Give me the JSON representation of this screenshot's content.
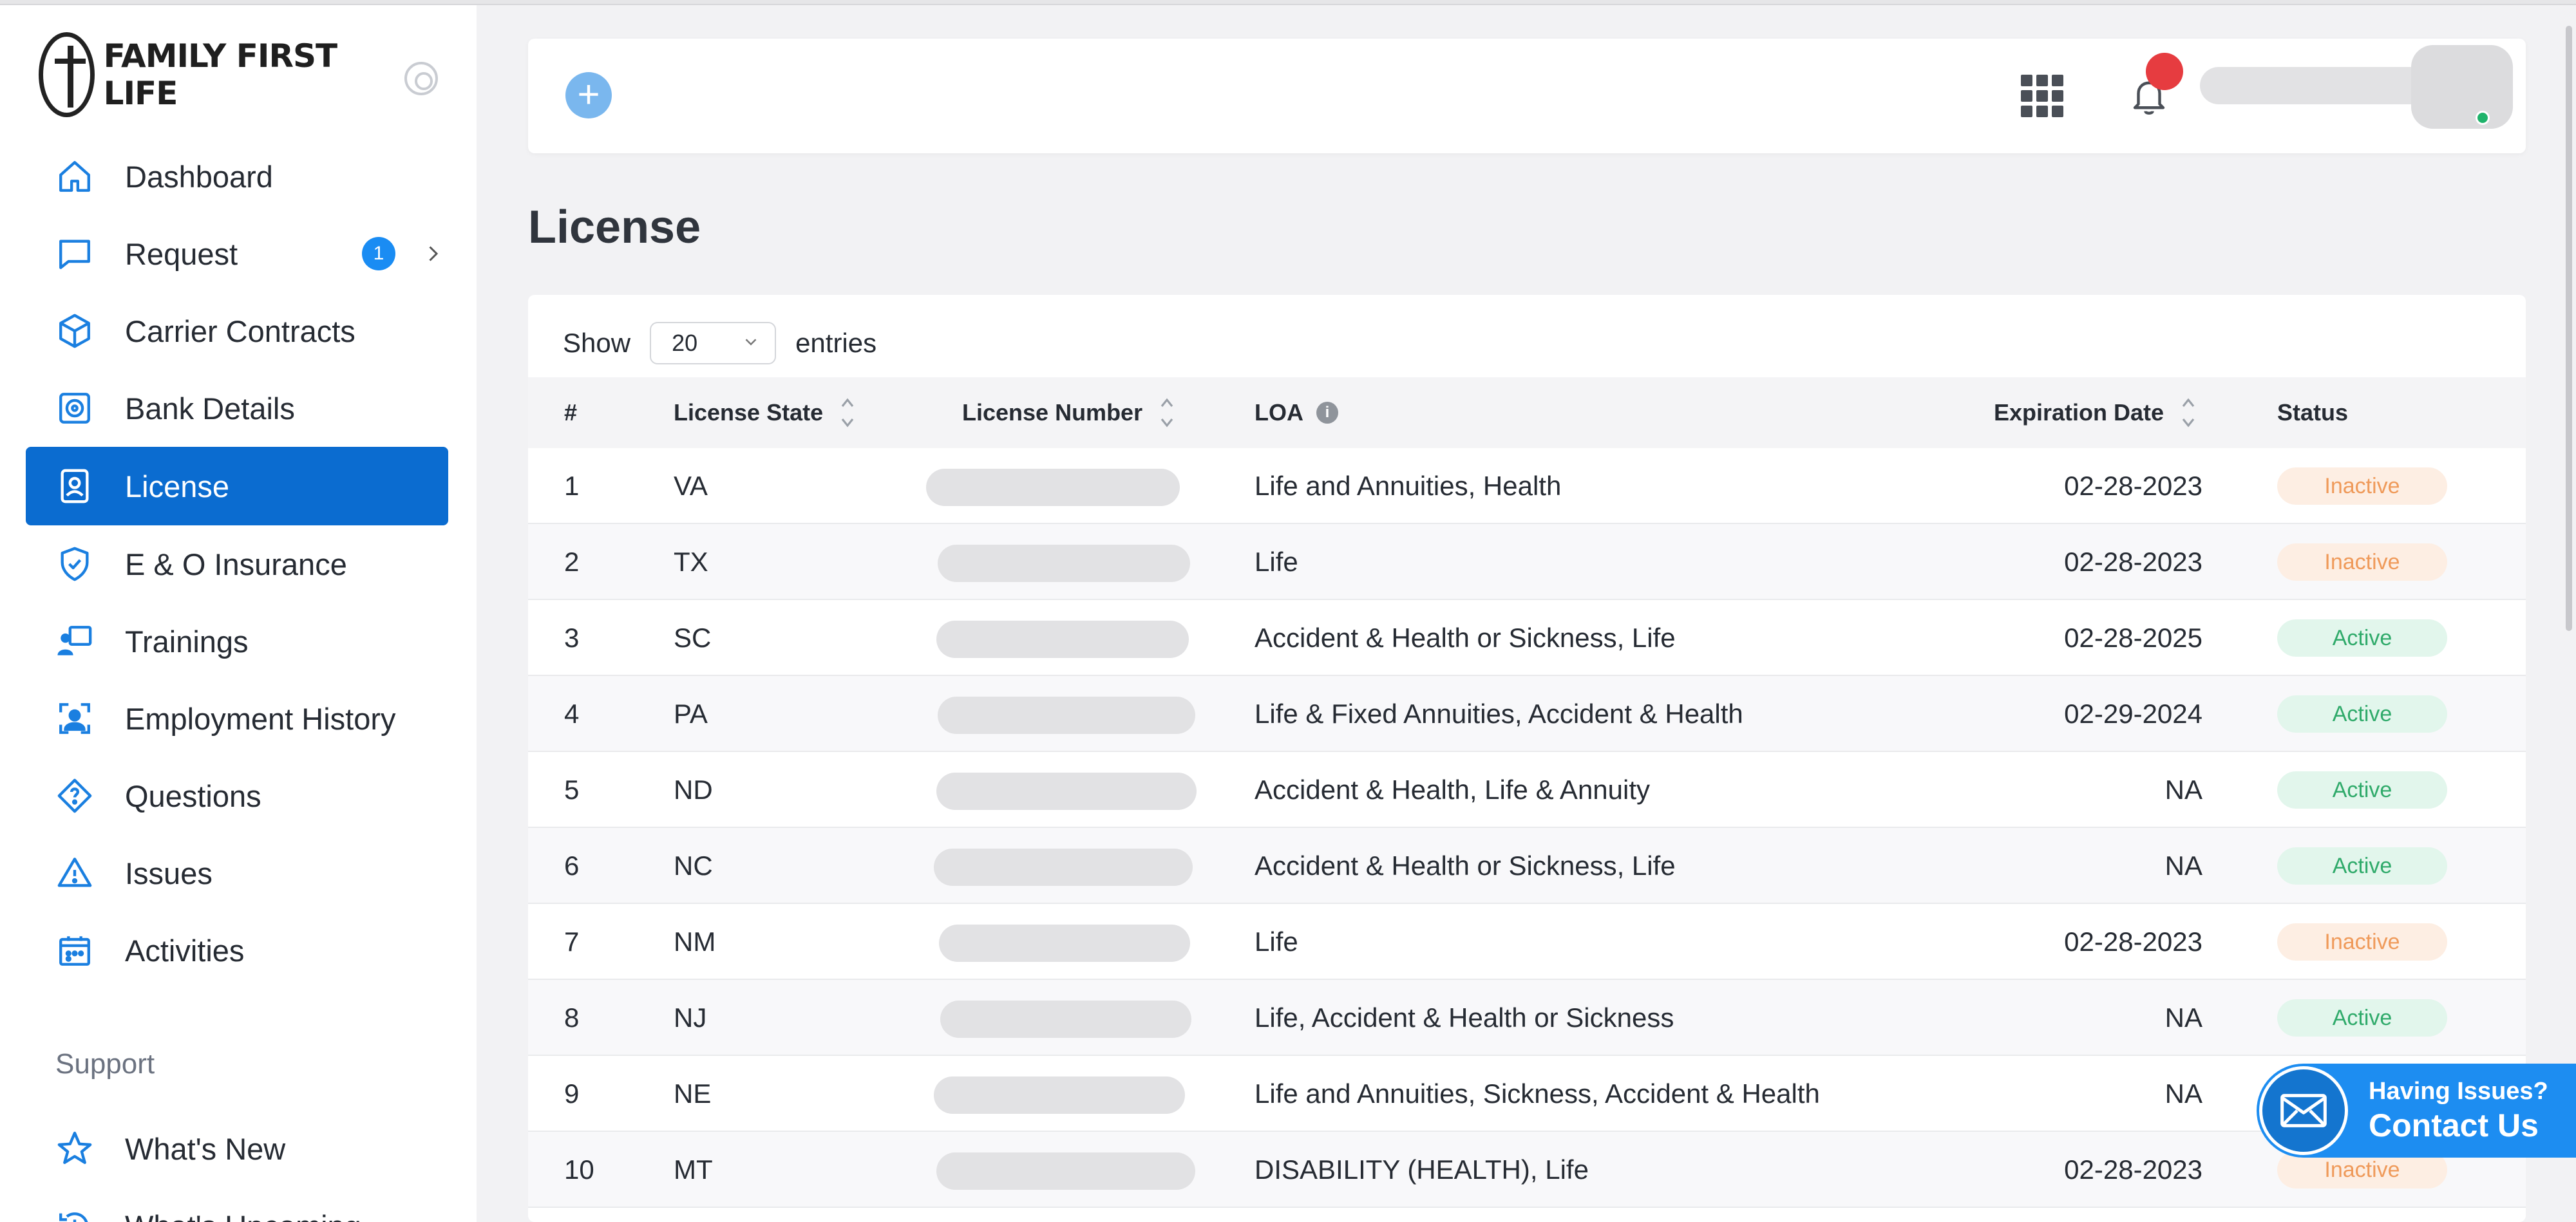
{
  "brand": {
    "name": "FAMILY FIRST LIFE"
  },
  "sidebar": {
    "items": [
      {
        "label": "Dashboard",
        "icon": "home-icon"
      },
      {
        "label": "Request",
        "icon": "chat-icon",
        "badge": "1"
      },
      {
        "label": "Carrier Contracts",
        "icon": "box-icon"
      },
      {
        "label": "Bank Details",
        "icon": "bank-icon"
      },
      {
        "label": "License",
        "icon": "license-icon",
        "active": true
      },
      {
        "label": "E & O Insurance",
        "icon": "shield-icon"
      },
      {
        "label": "Trainings",
        "icon": "training-icon"
      },
      {
        "label": "Employment History",
        "icon": "employee-icon"
      },
      {
        "label": "Questions",
        "icon": "question-icon"
      },
      {
        "label": "Issues",
        "icon": "warning-icon"
      },
      {
        "label": "Activities",
        "icon": "calendar-icon"
      }
    ],
    "support_label": "Support",
    "support_items": [
      {
        "label": "What's New",
        "icon": "star-icon"
      },
      {
        "label": "What's Upcoming",
        "icon": "history-icon"
      }
    ]
  },
  "page": {
    "title": "License"
  },
  "table": {
    "show_label": "Show",
    "entries_value": "20",
    "entries_label": "entries",
    "columns": [
      "#",
      "License State",
      "License Number",
      "LOA",
      "Expiration Date",
      "Status"
    ],
    "rows": [
      {
        "num": "1",
        "state": "VA",
        "loa": "Life and Annuities, Health",
        "expiration": "02-28-2023",
        "status": "Inactive"
      },
      {
        "num": "2",
        "state": "TX",
        "loa": "Life",
        "expiration": "02-28-2023",
        "status": "Inactive"
      },
      {
        "num": "3",
        "state": "SC",
        "loa": "Accident & Health or Sickness, Life",
        "expiration": "02-28-2025",
        "status": "Active"
      },
      {
        "num": "4",
        "state": "PA",
        "loa": "Life & Fixed Annuities, Accident & Health",
        "expiration": "02-29-2024",
        "status": "Active"
      },
      {
        "num": "5",
        "state": "ND",
        "loa": "Accident & Health, Life & Annuity",
        "expiration": "NA",
        "status": "Active"
      },
      {
        "num": "6",
        "state": "NC",
        "loa": "Accident & Health or Sickness, Life",
        "expiration": "NA",
        "status": "Active"
      },
      {
        "num": "7",
        "state": "NM",
        "loa": "Life",
        "expiration": "02-28-2023",
        "status": "Inactive"
      },
      {
        "num": "8",
        "state": "NJ",
        "loa": "Life, Accident & Health or Sickness",
        "expiration": "NA",
        "status": "Active"
      },
      {
        "num": "9",
        "state": "NE",
        "loa": "Life and Annuities, Sickness, Accident & Health",
        "expiration": "NA",
        "status": ""
      },
      {
        "num": "10",
        "state": "MT",
        "loa": "DISABILITY (HEALTH), Life",
        "expiration": "02-28-2023",
        "status": "Inactive"
      }
    ]
  },
  "contact_widget": {
    "line1": "Having Issues?",
    "line2": "Contact Us"
  },
  "colors": {
    "accent": "#0b6cd0",
    "active": "#2faa6a",
    "inactive": "#ef9a5a",
    "notification": "#e63c40"
  }
}
